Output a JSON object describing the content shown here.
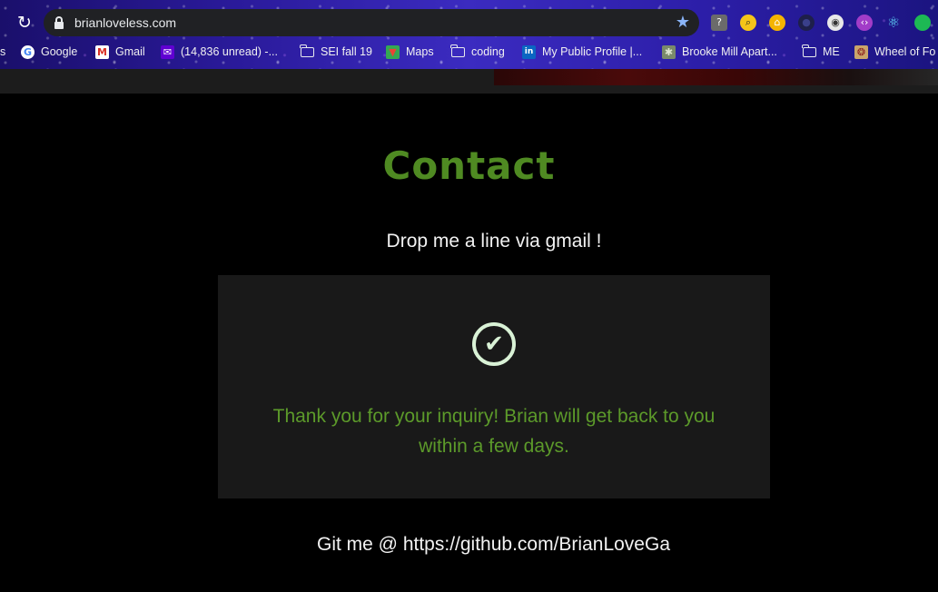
{
  "browser": {
    "url": "brianloveless.com",
    "bookmarks": [
      {
        "label": "s",
        "icon": "none"
      },
      {
        "label": "Google",
        "icon": "google-icon"
      },
      {
        "label": "Gmail",
        "icon": "gmail-icon"
      },
      {
        "label": "(14,836 unread) -...",
        "icon": "yahoo-mail-icon"
      },
      {
        "label": "SEI fall 19",
        "icon": "folder-icon"
      },
      {
        "label": "Maps",
        "icon": "maps-icon"
      },
      {
        "label": "coding",
        "icon": "folder-icon"
      },
      {
        "label": "My Public Profile |...",
        "icon": "linkedin-icon"
      },
      {
        "label": "Brooke Mill Apart...",
        "icon": "apartment-icon"
      },
      {
        "label": "ME",
        "icon": "folder-icon"
      },
      {
        "label": "Wheel of Fo",
        "icon": "wheel-icon"
      }
    ]
  },
  "page": {
    "title": "Contact",
    "subline": "Drop me a line via gmail !",
    "thanks": "Thank you for your inquiry! Brian will get back to you within a few days.",
    "git": "Git me @ https://github.com/BrianLoveGa"
  },
  "colors": {
    "accent_green": "#4f8a22",
    "panel_bg": "#191919",
    "check": "#d9f2d6"
  }
}
